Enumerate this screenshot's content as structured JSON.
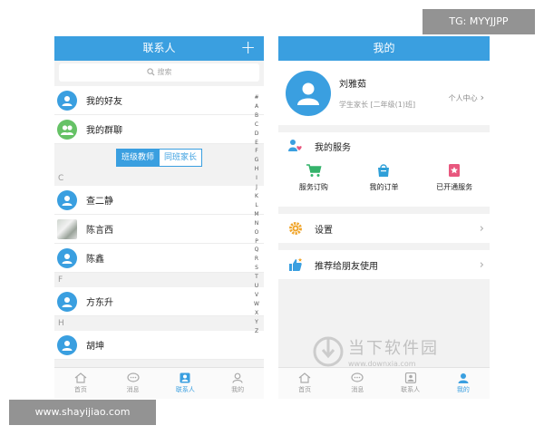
{
  "contacts": {
    "title": "联系人",
    "plus_symbol": "+",
    "search_placeholder": "搜索",
    "top_items": [
      "我的好友",
      "我的群聊"
    ],
    "tabs": [
      "班级教师",
      "同班家长"
    ],
    "sections": [
      {
        "letter": "C",
        "items": [
          "查二静",
          "陈言西",
          "陈鑫"
        ]
      },
      {
        "letter": "F",
        "items": [
          "方东升"
        ]
      },
      {
        "letter": "H",
        "items": [
          "胡坤"
        ]
      }
    ],
    "alphabet": [
      "#",
      "A",
      "B",
      "C",
      "D",
      "E",
      "F",
      "G",
      "H",
      "I",
      "J",
      "K",
      "L",
      "M",
      "N",
      "O",
      "P",
      "Q",
      "R",
      "S",
      "T",
      "U",
      "V",
      "W",
      "X",
      "Y",
      "Z"
    ]
  },
  "profile": {
    "title": "我的",
    "name": "刘雅茹",
    "role": "学生家长 [二年级(1)班]",
    "center_link": "个人中心",
    "services_title": "我的服务",
    "services": [
      "服务订购",
      "我的订单",
      "已开通服务"
    ],
    "settings": "设置",
    "recommend": "推荐给朋友使用"
  },
  "tabbar": {
    "labels": [
      "首页",
      "消息",
      "联系人",
      "我的"
    ]
  },
  "colors": {
    "accent": "#3a9fe0",
    "green": "#66c266",
    "cart": "#35b36b",
    "bag": "#2f9fd8",
    "star_badge": "#e8577e",
    "gear": "#f0a52b"
  },
  "watermarks": {
    "tag": "TG: MYYJJPP",
    "site": "www.shayijiao.com",
    "logo_cn": "当下软件园",
    "logo_url": "www.downxia.com"
  }
}
